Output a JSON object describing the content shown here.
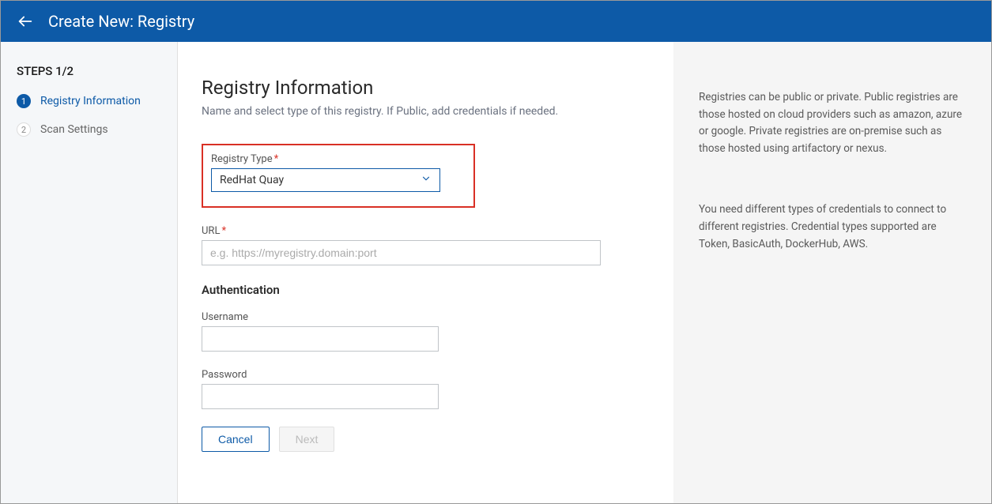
{
  "header": {
    "title": "Create New: Registry"
  },
  "sidebar": {
    "steps_label": "STEPS 1/2",
    "steps": [
      {
        "num": "1",
        "label": "Registry Information",
        "active": true
      },
      {
        "num": "2",
        "label": "Scan Settings",
        "active": false
      }
    ]
  },
  "main": {
    "title": "Registry Information",
    "subtitle": "Name and select type of this registry. If Public, add credentials if needed.",
    "registry_type": {
      "label": "Registry Type",
      "value": "RedHat Quay"
    },
    "url": {
      "label": "URL",
      "placeholder": "e.g. https://myregistry.domain:port",
      "value": ""
    },
    "auth_section": "Authentication",
    "username": {
      "label": "Username",
      "value": ""
    },
    "password": {
      "label": "Password",
      "value": ""
    },
    "cancel": "Cancel",
    "next": "Next"
  },
  "right": {
    "p1": "Registries can be public or private. Public registries are those hosted on cloud providers such as amazon, azure or google. Private registries are on-premise such as those hosted using artifactory or nexus.",
    "p2": "You need different types of credentials to connect to different registries. Credential types supported are Token, BasicAuth, DockerHub, AWS."
  }
}
